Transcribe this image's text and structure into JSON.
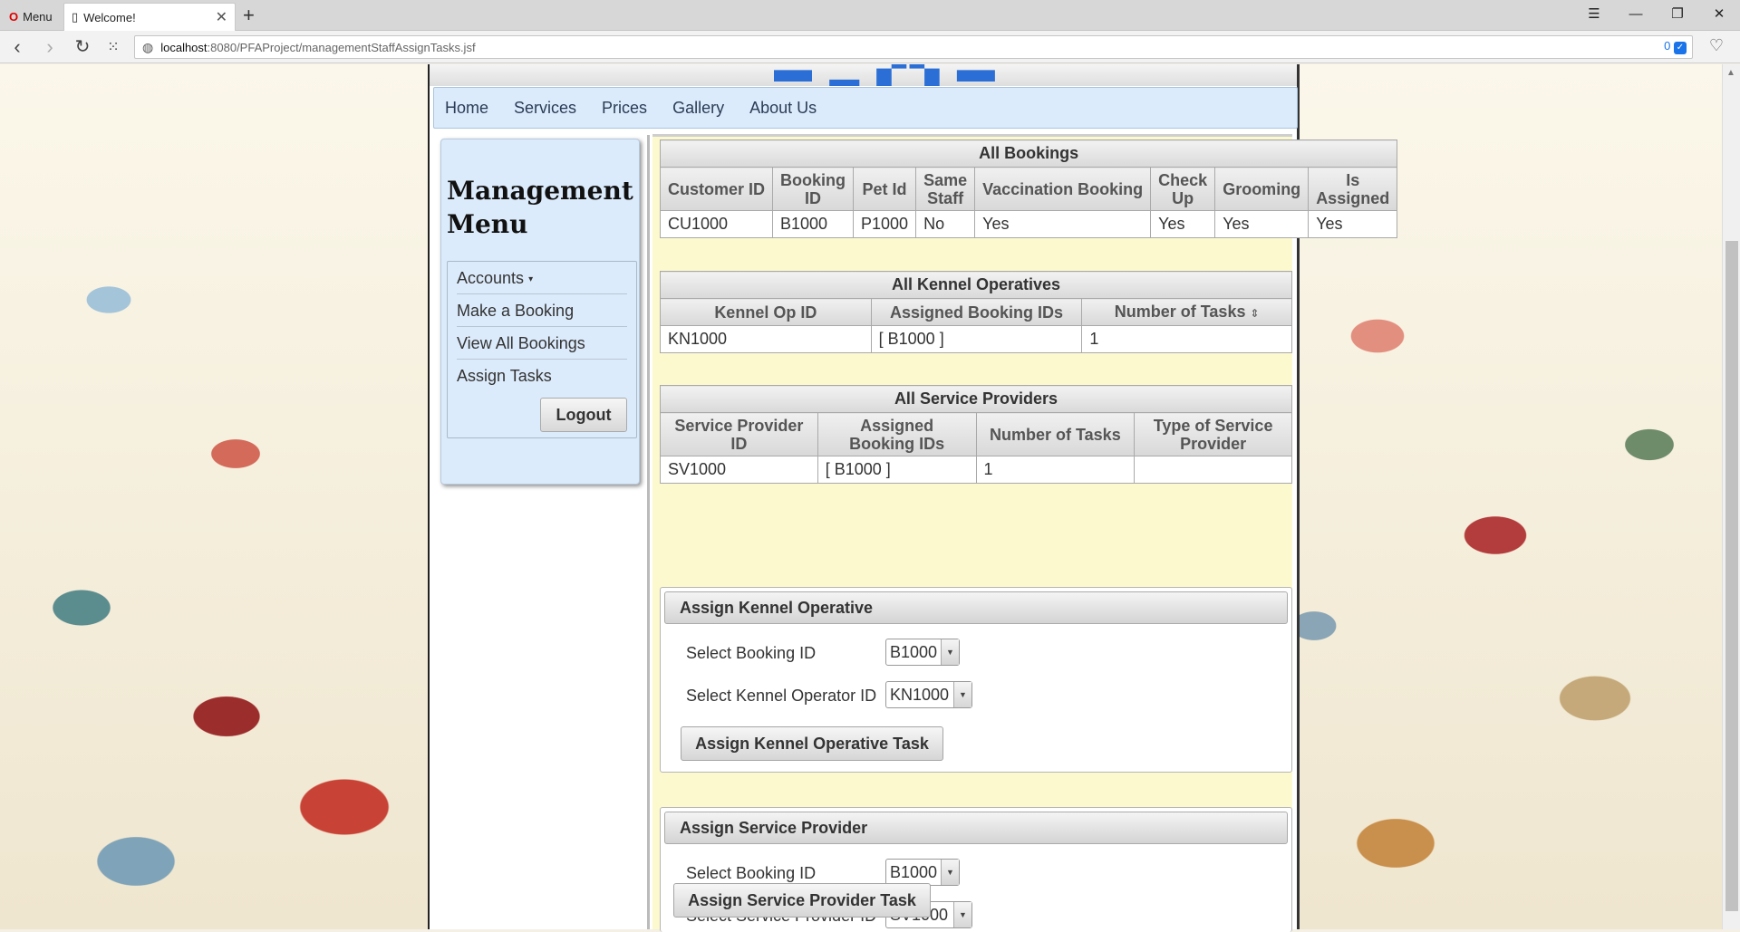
{
  "browser": {
    "menu_label": "Menu",
    "tab_title": "Welcome!",
    "url_host": "localhost",
    "url_path": ":8080/PFAProject/managementStaffAssignTasks.jsf",
    "badge_count": "0"
  },
  "nav": [
    "Home",
    "Services",
    "Prices",
    "Gallery",
    "About Us"
  ],
  "sidebar": {
    "title_line1": "Management",
    "title_line2": "Menu",
    "items": [
      "Accounts",
      "Make a Booking",
      "View All Bookings",
      "Assign Tasks"
    ],
    "logout_label": "Logout"
  },
  "bookings_table": {
    "caption": "All Bookings",
    "columns": [
      "Customer ID",
      "Booking ID",
      "Pet Id",
      "Same Staff",
      "Vaccination Booking",
      "Check Up",
      "Grooming",
      "Is Assigned"
    ],
    "rows": [
      [
        "CU1000",
        "B1000",
        "P1000",
        "No",
        "Yes",
        "Yes",
        "Yes",
        "Yes"
      ]
    ]
  },
  "kennel_table": {
    "caption": "All Kennel Operatives",
    "columns": [
      "Kennel Op ID",
      "Assigned Booking IDs",
      "Number of Tasks"
    ],
    "rows": [
      [
        "KN1000",
        "[ B1000 ]",
        "1"
      ]
    ]
  },
  "provider_table": {
    "caption": "All Service Providers",
    "columns": [
      "Service Provider ID",
      "Assigned Booking IDs",
      "Number of Tasks",
      "Type of Service Provider"
    ],
    "rows": [
      [
        "SV1000",
        "[ B1000 ]",
        "1",
        ""
      ]
    ]
  },
  "assign_kennel": {
    "title": "Assign Kennel Operative",
    "booking_label": "Select Booking ID",
    "booking_value": "B1000",
    "operator_label": "Select Kennel Operator ID",
    "operator_value": "KN1000",
    "button_label": "Assign Kennel Operative Task"
  },
  "assign_provider": {
    "title": "Assign Service Provider",
    "booking_label": "Select Booking ID",
    "booking_value": "B1000",
    "provider_label": "Select Service Provider ID",
    "provider_value": "SV1000",
    "button_label": "Assign Service Provider Task"
  }
}
